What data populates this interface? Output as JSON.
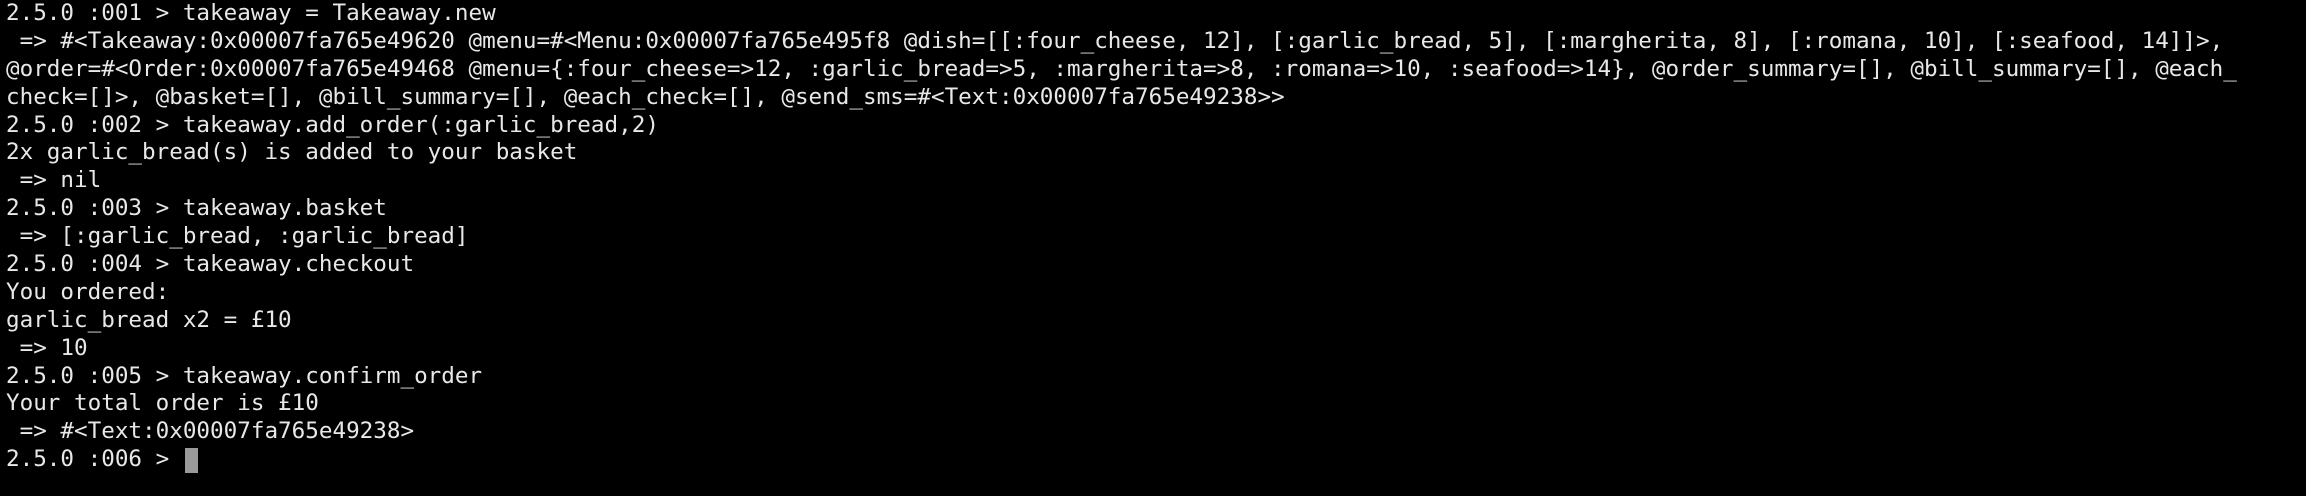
{
  "colors": {
    "background": "#000000",
    "text": "#e8e8e8",
    "cursor": "#9a9a9a"
  },
  "terminal": {
    "lines": [
      "2.5.0 :001 > takeaway = Takeaway.new",
      " => #<Takeaway:0x00007fa765e49620 @menu=#<Menu:0x00007fa765e495f8 @dish=[[:four_cheese, 12], [:garlic_bread, 5], [:margherita, 8], [:romana, 10], [:seafood, 14]]>,",
      "@order=#<Order:0x00007fa765e49468 @menu={:four_cheese=>12, :garlic_bread=>5, :margherita=>8, :romana=>10, :seafood=>14}, @order_summary=[], @bill_summary=[], @each_",
      "check=[]>, @basket=[], @bill_summary=[], @each_check=[], @send_sms=#<Text:0x00007fa765e49238>>",
      "2.5.0 :002 > takeaway.add_order(:garlic_bread,2)",
      "2x garlic_bread(s) is added to your basket",
      " => nil",
      "2.5.0 :003 > takeaway.basket",
      " => [:garlic_bread, :garlic_bread]",
      "2.5.0 :004 > takeaway.checkout",
      "You ordered:",
      "garlic_bread x2 = £10",
      " => 10",
      "2.5.0 :005 > takeaway.confirm_order",
      "Your total order is £10",
      " => #<Text:0x00007fa765e49238>"
    ],
    "current_prompt": "2.5.0 :006 > "
  }
}
